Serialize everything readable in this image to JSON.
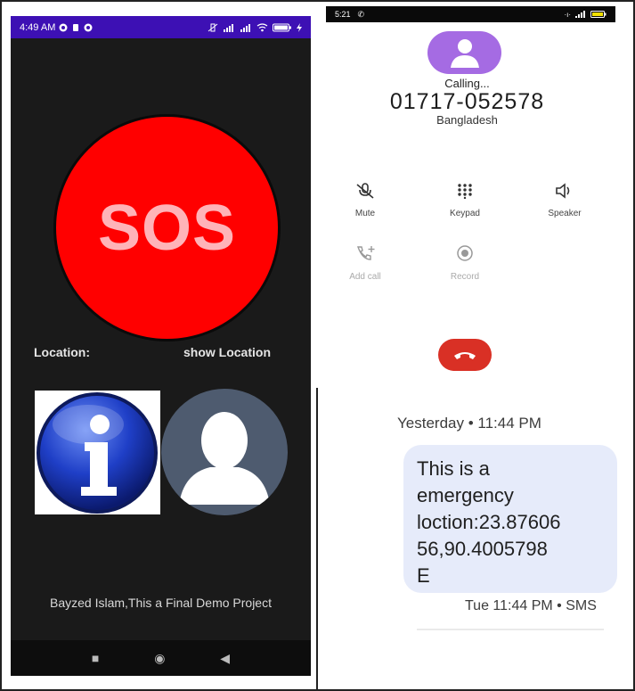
{
  "left_phone": {
    "status": {
      "time": "4:49 AM"
    },
    "sos_label": "SOS",
    "location_label": "Location:",
    "show_location_label": "show Location",
    "credit": "Bayzed Islam,This a Final Demo Project",
    "colors": {
      "status_bar": "#3d10b4",
      "background": "#1a1a1a",
      "sos": "#ff0000",
      "sos_text": "#ffb3b8"
    }
  },
  "call_screen": {
    "status": {
      "time": "5:21"
    },
    "status_text": "Calling...",
    "number": "01717-052578",
    "country": "Bangladesh",
    "controls": [
      {
        "label": "Mute",
        "icon": "mic-off-icon",
        "enabled": true
      },
      {
        "label": "Keypad",
        "icon": "keypad-icon",
        "enabled": true
      },
      {
        "label": "Speaker",
        "icon": "speaker-icon",
        "enabled": true
      },
      {
        "label": "Add call",
        "icon": "add-call-icon",
        "enabled": false
      },
      {
        "label": "Record",
        "icon": "record-icon",
        "enabled": false
      }
    ],
    "colors": {
      "avatar": "#a56be3",
      "end_call": "#d93025"
    }
  },
  "sms": {
    "date_header": "Yesterday • 11:44 PM",
    "message_lines": [
      "This is a",
      "emergency",
      "loction:23.87606",
      "56,90.4005798",
      "E"
    ],
    "meta": "Tue 11:44 PM • SMS",
    "colors": {
      "bubble": "#e6ebfa"
    }
  }
}
